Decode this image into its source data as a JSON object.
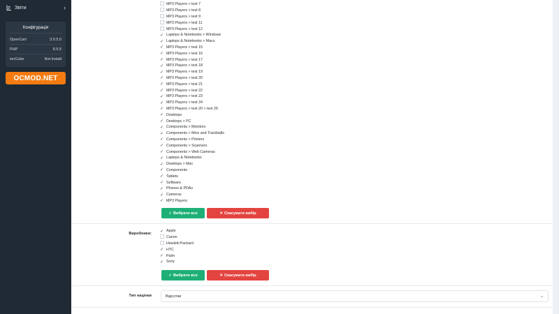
{
  "sidebar": {
    "reports_label": "Звіти",
    "config": {
      "title": "Конфігурація",
      "rows": [
        {
          "key": "OpenCart",
          "value": "3.0.5.0"
        },
        {
          "key": "PHP",
          "value": "8.5.5"
        },
        {
          "key": "ionCube",
          "value": "Not Install"
        }
      ]
    },
    "ocmod_label": "OCMOD.NET"
  },
  "categories": [
    {
      "label": "MP3 Players  >  test 7",
      "checked": false
    },
    {
      "label": "MP3 Players  >  test 8",
      "checked": false
    },
    {
      "label": "MP3 Players  >  test 9",
      "checked": false
    },
    {
      "label": "MP3 Players  >  test 11",
      "checked": false
    },
    {
      "label": "MP3 Players  >  test 12",
      "checked": false
    },
    {
      "label": "Laptops & Notebooks  >  Windows",
      "checked": true
    },
    {
      "label": "Laptops & Notebooks  >  Macs",
      "checked": true
    },
    {
      "label": "MP3 Players  >  test 15",
      "checked": true
    },
    {
      "label": "MP3 Players  >  test 16",
      "checked": true
    },
    {
      "label": "MP3 Players  >  test 17",
      "checked": true
    },
    {
      "label": "MP3 Players  >  test 18",
      "checked": true
    },
    {
      "label": "MP3 Players  >  test 19",
      "checked": true
    },
    {
      "label": "MP3 Players  >  test 20",
      "checked": true
    },
    {
      "label": "MP3 Players  >  test 21",
      "checked": true
    },
    {
      "label": "MP3 Players  >  test 22",
      "checked": true
    },
    {
      "label": "MP3 Players  >  test 23",
      "checked": true
    },
    {
      "label": "MP3 Players  >  test 24",
      "checked": true
    },
    {
      "label": "MP3 Players  >  test 20  >  test 25",
      "checked": true
    },
    {
      "label": "Desktops",
      "checked": true
    },
    {
      "label": "Desktops  >  PC",
      "checked": true
    },
    {
      "label": "Components  >  Monitors",
      "checked": true
    },
    {
      "label": "Components  >  Mice and Trackballs",
      "checked": true
    },
    {
      "label": "Components  >  Printers",
      "checked": true
    },
    {
      "label": "Components  >  Scanners",
      "checked": true
    },
    {
      "label": "Components  >  Web Cameras",
      "checked": true
    },
    {
      "label": "Laptops & Notebooks",
      "checked": true
    },
    {
      "label": "Desktops  >  Mac",
      "checked": true
    },
    {
      "label": "Components",
      "checked": true
    },
    {
      "label": "Tablets",
      "checked": true
    },
    {
      "label": "Software",
      "checked": true
    },
    {
      "label": "Phones & PDAs",
      "checked": true
    },
    {
      "label": "Cameras",
      "checked": true
    },
    {
      "label": "MP3 Players",
      "checked": true
    }
  ],
  "buttons": {
    "select_all": "Вибрати все",
    "cancel_selection": "Скасувати вибір"
  },
  "manufacturers": {
    "label": "Виробники:",
    "items": [
      {
        "label": "Apple",
        "checked": true
      },
      {
        "label": "Canon",
        "checked": false
      },
      {
        "label": "Hewlett-Packard",
        "checked": false
      },
      {
        "label": "HTC",
        "checked": true
      },
      {
        "label": "Palm",
        "checked": true
      },
      {
        "label": "Sony",
        "checked": true
      }
    ]
  },
  "markup_type": {
    "label": "Тип націнки",
    "value": "Відсотки"
  }
}
